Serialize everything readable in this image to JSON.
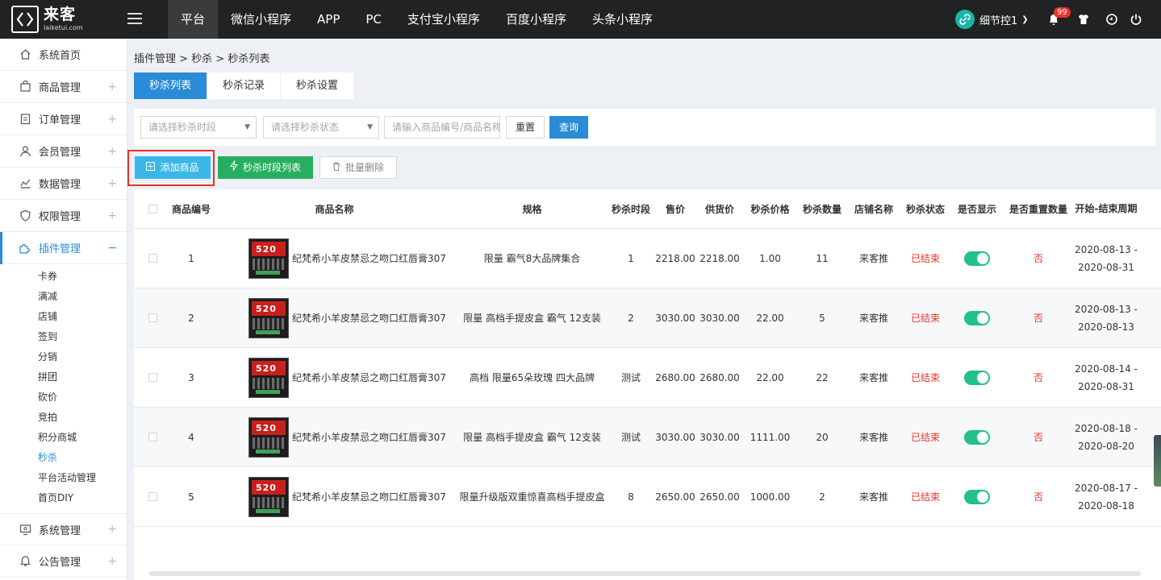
{
  "brand": {
    "name_cn": "来客",
    "name_en": "laiketui.com"
  },
  "topnav": [
    "平台",
    "微信小程序",
    "APP",
    "PC",
    "支付宝小程序",
    "百度小程序",
    "头条小程序"
  ],
  "user": {
    "name": "细节控1",
    "notifications": "99"
  },
  "sidebar": {
    "items": [
      {
        "label": "系统首页",
        "icon": "home-icon",
        "expandable": false
      },
      {
        "label": "商品管理",
        "icon": "bag-icon",
        "expandable": true
      },
      {
        "label": "订单管理",
        "icon": "clipboard-icon",
        "expandable": true
      },
      {
        "label": "会员管理",
        "icon": "user-icon",
        "expandable": true
      },
      {
        "label": "数据管理",
        "icon": "chart-icon",
        "expandable": true
      },
      {
        "label": "权限管理",
        "icon": "shield-icon",
        "expandable": true
      },
      {
        "label": "插件管理",
        "icon": "puzzle-icon",
        "expandable": true,
        "open": true
      }
    ],
    "subitems": [
      "卡券",
      "满减",
      "店铺",
      "签到",
      "分销",
      "拼团",
      "砍价",
      "竞拍",
      "积分商城",
      "秒杀",
      "平台活动管理",
      "首页DIY"
    ],
    "bottom_items": [
      {
        "label": "系统管理",
        "icon": "monitor-icon"
      },
      {
        "label": "公告管理",
        "icon": "bell-icon"
      }
    ]
  },
  "breadcrumb": "插件管理 > 秒杀 > 秒杀列表",
  "tabs": [
    "秒杀列表",
    "秒杀记录",
    "秒杀设置"
  ],
  "filters": {
    "slot_placeholder": "请选择秒杀时段",
    "status_placeholder": "请选择秒杀状态",
    "keyword_placeholder": "请输入商品编号/商品名称",
    "reset": "重置",
    "query": "查询"
  },
  "actions": {
    "add": "添加商品",
    "slots": "秒杀时段列表",
    "batch_delete": "批量删除"
  },
  "table": {
    "headers": [
      "商品编号",
      "商品名称",
      "规格",
      "秒杀时段",
      "售价",
      "供货价",
      "秒杀价格",
      "秒杀数量",
      "店铺名称",
      "秒杀状态",
      "是否显示",
      "是否重置数量",
      "开始-结束周期"
    ],
    "thumb_text": "520",
    "rows": [
      {
        "no": "1",
        "name": "纪梵希小羊皮禁忌之吻口红唇膏307",
        "spec": "限量 霸气8大品牌集合",
        "slot": "1",
        "price": "2218.00",
        "supply": "2218.00",
        "skill_price": "1.00",
        "qty": "11",
        "shop": "来客推",
        "status": "已结束",
        "show": true,
        "reset": "否",
        "start": "2020-08-13 -",
        "end": "2020-08-31"
      },
      {
        "no": "2",
        "name": "纪梵希小羊皮禁忌之吻口红唇膏307",
        "spec": "限量 高档手提皮盒 霸气 12支装",
        "slot": "2",
        "price": "3030.00",
        "supply": "3030.00",
        "skill_price": "22.00",
        "qty": "5",
        "shop": "来客推",
        "status": "已结束",
        "show": true,
        "reset": "否",
        "start": "2020-08-13 -",
        "end": "2020-08-13"
      },
      {
        "no": "3",
        "name": "纪梵希小羊皮禁忌之吻口红唇膏307",
        "spec": "高档 限量65朵玫瑰 四大品牌",
        "slot": "测试",
        "price": "2680.00",
        "supply": "2680.00",
        "skill_price": "22.00",
        "qty": "22",
        "shop": "来客推",
        "status": "已结束",
        "show": true,
        "reset": "否",
        "start": "2020-08-14 -",
        "end": "2020-08-31"
      },
      {
        "no": "4",
        "name": "纪梵希小羊皮禁忌之吻口红唇膏307",
        "spec": "限量 高档手提皮盒 霸气 12支装",
        "slot": "测试",
        "price": "3030.00",
        "supply": "3030.00",
        "skill_price": "1111.00",
        "qty": "20",
        "shop": "来客推",
        "status": "已结束",
        "show": true,
        "reset": "否",
        "start": "2020-08-18 -",
        "end": "2020-08-20"
      },
      {
        "no": "5",
        "name": "纪梵希小羊皮禁忌之吻口红唇膏307",
        "spec": "限量升级版双重惊喜高档手提皮盒",
        "slot": "8",
        "price": "2650.00",
        "supply": "2650.00",
        "skill_price": "1000.00",
        "qty": "2",
        "shop": "来客推",
        "status": "已结束",
        "show": true,
        "reset": "否",
        "start": "2020-08-17 -",
        "end": "2020-08-18"
      }
    ]
  }
}
